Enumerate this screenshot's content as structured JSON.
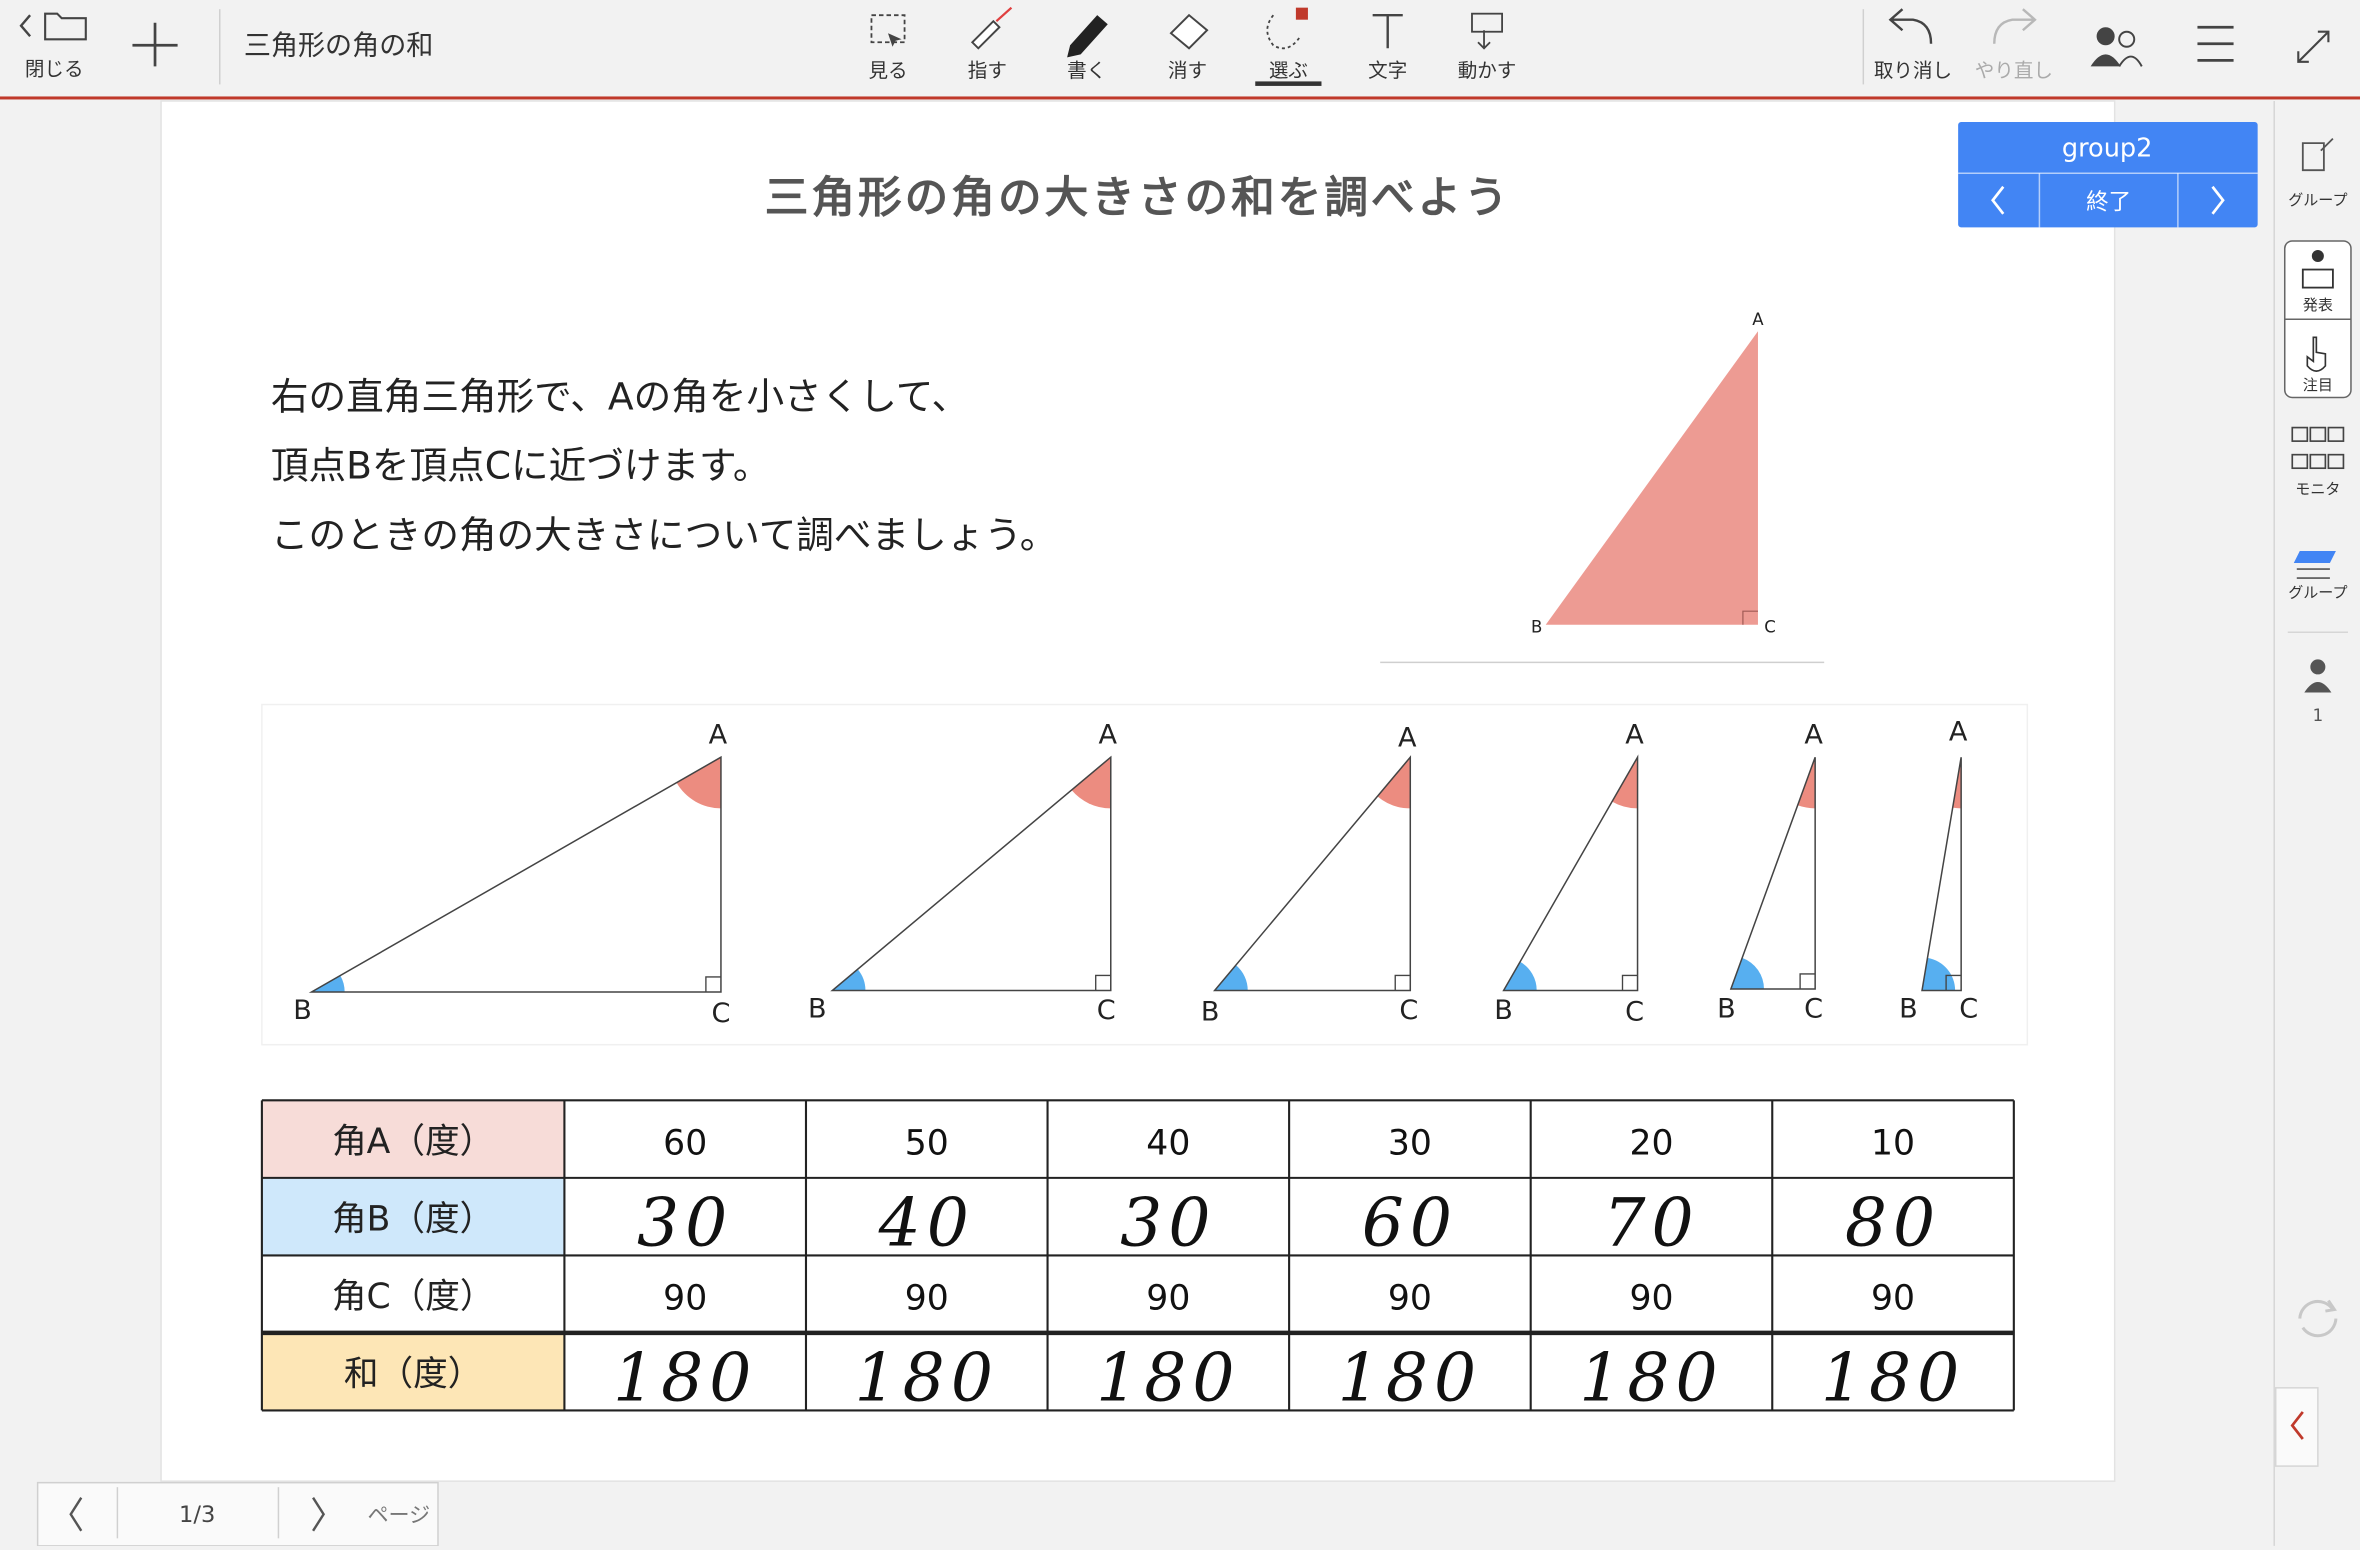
{
  "toolbar": {
    "close_label": "閉じる",
    "doc_title": "三角形の角の和",
    "tools": [
      {
        "label": "見る"
      },
      {
        "label": "指す"
      },
      {
        "label": "書く"
      },
      {
        "label": "消す"
      },
      {
        "label": "選ぶ"
      },
      {
        "label": "文字"
      },
      {
        "label": "動かす"
      }
    ],
    "undo_label": "取り消し",
    "redo_label": "やり直し"
  },
  "group_panel": {
    "name": "group2",
    "end_label": "終了"
  },
  "side": {
    "group_top": "グループ",
    "present": "発表",
    "focus": "注目",
    "monitor": "モニタ",
    "group_bottom": "グループ",
    "user_count": "1"
  },
  "page": {
    "heading": "三角形の角の大きさの和を調べよう",
    "instructions": [
      "右の直角三角形で、Aの角を小さくして、",
      "頂点Bを頂点Cに近づけます。",
      "このときの角の大きさについて調べましょう。"
    ]
  },
  "vertex_labels": {
    "a": "A",
    "b": "B",
    "c": "C"
  },
  "table": {
    "rows": [
      {
        "header": "角A（度）",
        "color": "#f7dcd8",
        "values": [
          "60",
          "50",
          "40",
          "30",
          "20",
          "10"
        ],
        "handwritten": false
      },
      {
        "header": "角B（度）",
        "color": "#cfe8fb",
        "values": [
          "30",
          "40",
          "30",
          "60",
          "70",
          "80"
        ],
        "handwritten": true
      },
      {
        "header": "角C（度）",
        "color": "#ffffff",
        "values": [
          "90",
          "90",
          "90",
          "90",
          "90",
          "90"
        ],
        "handwritten": false
      },
      {
        "header": "和（度）",
        "color": "#fde6b6",
        "values": [
          "180",
          "180",
          "180",
          "180",
          "180",
          "180"
        ],
        "handwritten": true
      }
    ]
  },
  "pager": {
    "page_indicator": "1/3",
    "page_label": "ページ"
  },
  "colors": {
    "accent_red": "#c0392b",
    "angle_red": "#ec8c80",
    "angle_blue": "#57aff0",
    "group_blue": "#4285f4",
    "triangle_fill": "#ed9b93"
  }
}
